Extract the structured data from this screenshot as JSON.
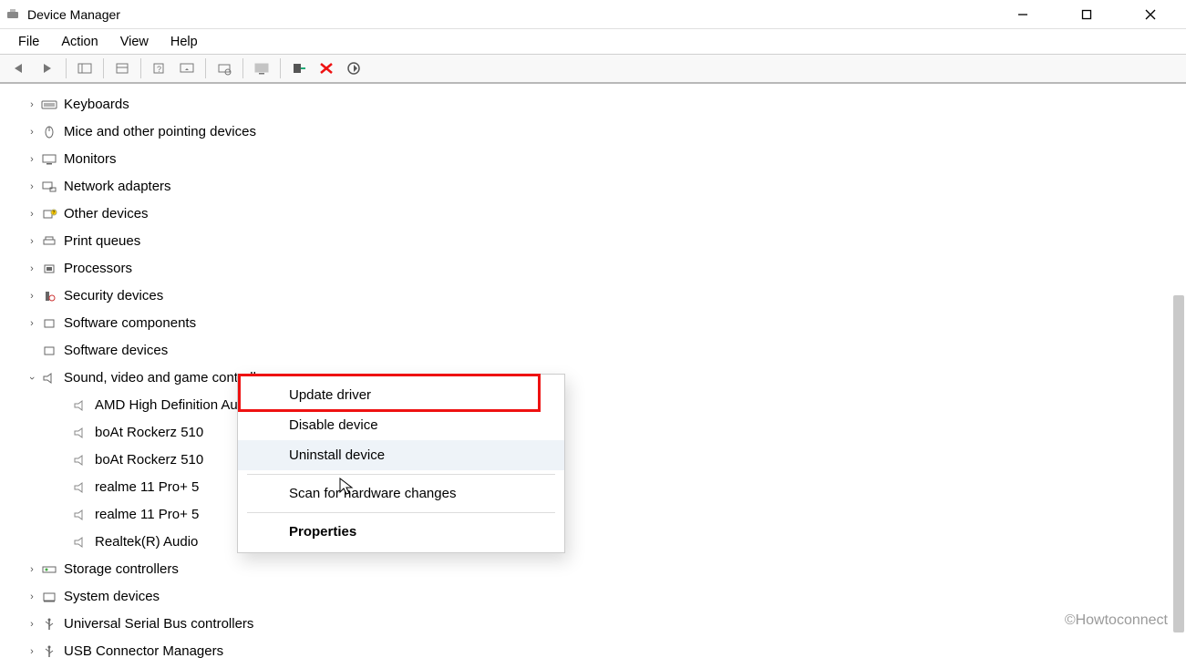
{
  "window": {
    "title": "Device Manager"
  },
  "menubar": {
    "items": [
      "File",
      "Action",
      "View",
      "Help"
    ]
  },
  "toolbar_icons": {
    "back": "back-icon",
    "forward": "forward-icon",
    "up": "show-hide-tree-icon",
    "properties": "properties-icon",
    "help": "help-icon",
    "monitor": "monitor-icon",
    "scan": "scan-icon",
    "display": "display-icon",
    "add": "add-legacy-icon",
    "remove": "remove-icon",
    "refresh": "refresh-icon"
  },
  "tree": {
    "top": [
      {
        "label": "Keyboards",
        "icon": "keyboard"
      },
      {
        "label": "Mice and other pointing devices",
        "icon": "mouse"
      },
      {
        "label": "Monitors",
        "icon": "monitor"
      },
      {
        "label": "Network adapters",
        "icon": "network"
      },
      {
        "label": "Other devices",
        "icon": "other"
      },
      {
        "label": "Print queues",
        "icon": "printer"
      },
      {
        "label": "Processors",
        "icon": "cpu"
      },
      {
        "label": "Security devices",
        "icon": "security"
      },
      {
        "label": "Software components",
        "icon": "software"
      },
      {
        "label": "Software devices",
        "icon": "software"
      }
    ],
    "expanded": {
      "label": "Sound, video and game controllers",
      "icon": "sound",
      "children": [
        "AMD High Definition Audio Device",
        "boAt Rockerz 510",
        "boAt Rockerz 510",
        "realme 11 Pro+ 5",
        "realme 11 Pro+ 5",
        "Realtek(R) Audio"
      ]
    },
    "bottom": [
      {
        "label": "Storage controllers",
        "icon": "storage"
      },
      {
        "label": "System devices",
        "icon": "system"
      },
      {
        "label": "Universal Serial Bus controllers",
        "icon": "usb"
      },
      {
        "label": "USB Connector Managers",
        "icon": "usbconn"
      }
    ]
  },
  "context_menu": {
    "items": [
      {
        "label": "Update driver",
        "highlighted": true
      },
      {
        "label": "Disable device"
      },
      {
        "label": "Uninstall device",
        "hover": true
      },
      {
        "sep": true
      },
      {
        "label": "Scan for hardware changes"
      },
      {
        "sep": true
      },
      {
        "label": "Properties",
        "bold": true
      }
    ]
  },
  "watermark": "©Howtoconnect"
}
